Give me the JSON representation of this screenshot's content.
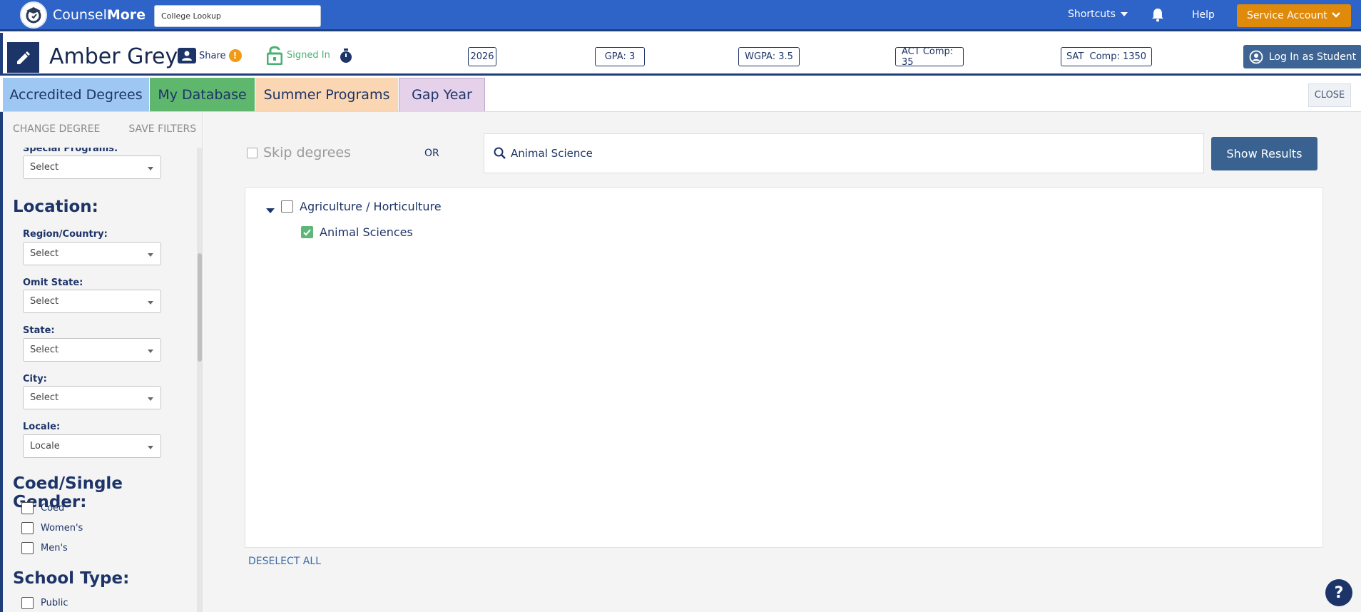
{
  "app": {
    "brand_light": "Counsel",
    "brand_bold": "More"
  },
  "header": {
    "college_lookup_placeholder": "College Lookup",
    "shortcuts_label": "Shortcuts",
    "help_label": "Help",
    "service_account_label": "Service Account"
  },
  "student": {
    "name": "Amber Grey",
    "share_label": "Share",
    "share_alert": "!",
    "signed_in_label": "Signed In",
    "badges": [
      {
        "label": "2026"
      },
      {
        "label": "GPA: 3"
      },
      {
        "label": "WGPA: 3.5"
      },
      {
        "label": "ACT Comp: 35"
      },
      {
        "label": "SAT  Comp: 1350"
      }
    ],
    "login_as_student_label": "Log In as Student"
  },
  "tabs": [
    {
      "label": "Accredited Degrees"
    },
    {
      "label": "My Database"
    },
    {
      "label": "Summer Programs"
    },
    {
      "label": "Gap Year"
    }
  ],
  "close_label": "CLOSE",
  "sidebar": {
    "change_degree": "CHANGE DEGREE",
    "save_filters": "SAVE FILTERS",
    "special_programs": {
      "label": "Special Programs:",
      "value": "Select"
    },
    "location_heading": "Location:",
    "region": {
      "label": "Region/Country:",
      "value": "Select"
    },
    "omit_state": {
      "label": "Omit State:",
      "value": "Select"
    },
    "state": {
      "label": "State:",
      "value": "Select"
    },
    "city": {
      "label": "City:",
      "value": "Select"
    },
    "locale": {
      "label": "Locale:",
      "value": "Locale"
    },
    "gender_heading": "Coed/Single Gender:",
    "gender_options": [
      "Coed",
      "Women's",
      "Men's"
    ],
    "school_type_heading": "School Type:",
    "school_type_options": [
      "Public"
    ]
  },
  "main": {
    "skip_degrees_label": "Skip degrees",
    "or_label": "OR",
    "search_value": "Animal Science",
    "show_results_label": "Show Results",
    "tree": {
      "parent": {
        "label": "Agriculture / Horticulture",
        "checked": false
      },
      "child": {
        "label": "Animal Sciences",
        "checked": true
      }
    },
    "deselect_all_label": "DESELECT ALL"
  },
  "help_fab": "?",
  "colors": {
    "primary": "#2e63c7",
    "navy": "#1d3468",
    "orange": "#e08a0b",
    "green": "#5db877"
  }
}
